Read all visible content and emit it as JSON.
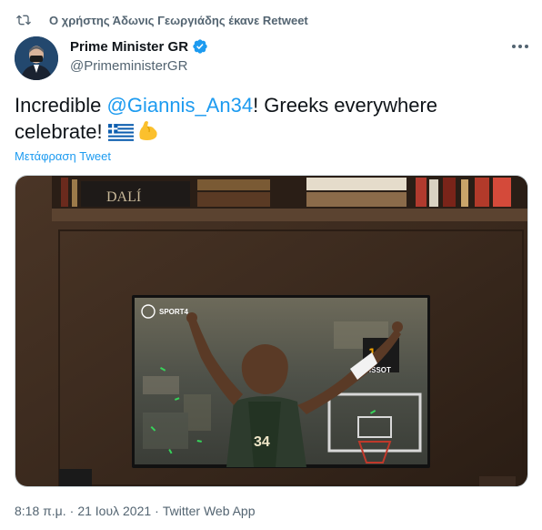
{
  "retweet": {
    "text": "Ο χρήστης Άδωνις Γεωργιάδης έκανε Retweet",
    "icon": "retweet-icon"
  },
  "author": {
    "name": "Prime Minister GR",
    "handle": "@PrimeministerGR",
    "verified": true
  },
  "tweet": {
    "prefix": "Incredible ",
    "mention": "@Giannis_An34",
    "line1_rest": "! Greeks everywhere",
    "line2": "celebrate!",
    "emoji": [
      "greek-flag",
      "flexed-biceps"
    ]
  },
  "translate_label": "Μετάφραση Tweet",
  "media": {
    "channel_logo": "SPORT4",
    "jersey_number": "34",
    "scoreboard": "TISSOT",
    "score_digits": "19",
    "shelf_book": "DALÍ"
  },
  "footer": {
    "time": "8:18 π.μ.",
    "separator1": "·",
    "date": "21 Ιουλ 2021",
    "separator2": "·",
    "source": "Twitter Web App"
  },
  "colors": {
    "link": "#1d9bf0",
    "secondary_text": "#536471",
    "primary_text": "#0f1419"
  }
}
